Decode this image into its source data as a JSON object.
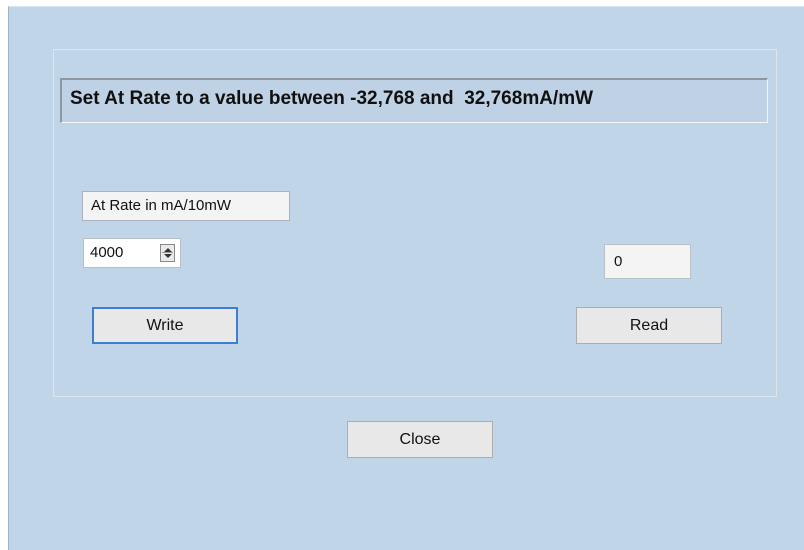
{
  "banner": {
    "text": "Set At Rate to a value between -32,768 and  32,768mA/mW"
  },
  "rate_field": {
    "label": "At Rate in mA/10mW",
    "value": "4000"
  },
  "read_value": "0",
  "buttons": {
    "write_label": "Write",
    "read_label": "Read",
    "close_label": "Close"
  }
}
